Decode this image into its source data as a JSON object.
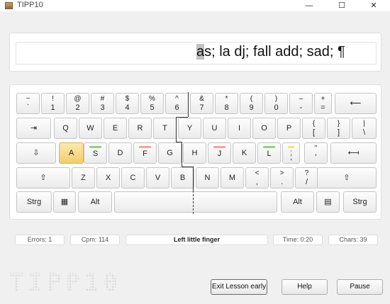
{
  "window": {
    "title": "TIPP10",
    "minimize": "—",
    "maximize": "☐",
    "close": "✕"
  },
  "text_display": {
    "before": "",
    "cursor": "a",
    "after": "s; la dj; fall add; sad; ¶"
  },
  "keyboard": {
    "rows": [
      [
        {
          "name": "key-circumflex",
          "top": "~",
          "bot": "`"
        },
        {
          "name": "key-1",
          "top": "!",
          "bot": "1"
        },
        {
          "name": "key-2",
          "top": "@",
          "bot": "2"
        },
        {
          "name": "key-3",
          "top": "#",
          "bot": "3"
        },
        {
          "name": "key-4",
          "top": "$",
          "bot": "4"
        },
        {
          "name": "key-5",
          "top": "%",
          "bot": "5"
        },
        {
          "name": "key-6",
          "top": "^",
          "bot": "6"
        },
        {
          "name": "key-7",
          "top": "&",
          "bot": "7"
        },
        {
          "name": "key-8",
          "top": "*",
          "bot": "8"
        },
        {
          "name": "key-9",
          "top": "(",
          "bot": "9"
        },
        {
          "name": "key-0",
          "top": ")",
          "bot": "0"
        },
        {
          "name": "key-minus",
          "top": "–",
          "bot": "-"
        },
        {
          "name": "key-plus",
          "top": "+",
          "bot": "="
        },
        {
          "name": "key-backspace",
          "mid": "⟵"
        }
      ],
      [
        {
          "name": "key-tab",
          "mid": "⇥"
        },
        {
          "name": "key-q",
          "mid": "Q"
        },
        {
          "name": "key-w",
          "mid": "W"
        },
        {
          "name": "key-e",
          "mid": "E"
        },
        {
          "name": "key-r",
          "mid": "R"
        },
        {
          "name": "key-t",
          "mid": "T"
        },
        {
          "name": "key-y",
          "mid": "Y"
        },
        {
          "name": "key-u",
          "mid": "U"
        },
        {
          "name": "key-i",
          "mid": "I"
        },
        {
          "name": "key-o",
          "mid": "O"
        },
        {
          "name": "key-p",
          "mid": "P"
        },
        {
          "name": "key-bracket-left",
          "top": "{",
          "bot": "["
        },
        {
          "name": "key-bracket-right",
          "top": "}",
          "bot": "]"
        },
        {
          "name": "key-backslash",
          "top": "|",
          "bot": "\\"
        }
      ],
      [
        {
          "name": "key-capslock",
          "mid": "⇩"
        },
        {
          "name": "key-a",
          "mid": "A",
          "highlight": true
        },
        {
          "name": "key-s",
          "mid": "S",
          "bar": "#8fd47a"
        },
        {
          "name": "key-d",
          "mid": "D"
        },
        {
          "name": "key-f",
          "mid": "F",
          "bar": "#f2a3a3"
        },
        {
          "name": "key-g",
          "mid": "G"
        },
        {
          "name": "key-h",
          "mid": "H"
        },
        {
          "name": "key-j",
          "mid": "J",
          "bar": "#f2a3a3"
        },
        {
          "name": "key-k",
          "mid": "K"
        },
        {
          "name": "key-l",
          "mid": "L",
          "bar": "#8fd47a"
        },
        {
          "name": "key-semicolon",
          "top": ":",
          "bot": ";",
          "bar": "#f5e27a"
        },
        {
          "name": "key-quote",
          "top": "\"",
          "bot": "'"
        },
        {
          "name": "key-enter",
          "mid": "⟻"
        }
      ],
      [
        {
          "name": "key-shift-left",
          "mid": "⇧"
        },
        {
          "name": "key-z",
          "mid": "Z"
        },
        {
          "name": "key-x",
          "mid": "X"
        },
        {
          "name": "key-c",
          "mid": "C"
        },
        {
          "name": "key-v",
          "mid": "V"
        },
        {
          "name": "key-b",
          "mid": "B"
        },
        {
          "name": "key-n",
          "mid": "N"
        },
        {
          "name": "key-m",
          "mid": "M"
        },
        {
          "name": "key-comma",
          "top": "<",
          "bot": ","
        },
        {
          "name": "key-period",
          "top": ">",
          "bot": "."
        },
        {
          "name": "key-slash",
          "top": "?",
          "bot": "/"
        },
        {
          "name": "key-shift-right",
          "mid": "⇧"
        }
      ],
      [
        {
          "name": "key-ctrl-left",
          "mid": "Strg"
        },
        {
          "name": "key-win-left",
          "mid": "▦"
        },
        {
          "name": "key-alt-left",
          "mid": "Alt"
        },
        {
          "name": "key-space",
          "mid": ""
        },
        {
          "name": "key-altgr",
          "mid": "Alt"
        },
        {
          "name": "key-menu",
          "mid": "▤"
        },
        {
          "name": "key-ctrl-right",
          "mid": "Strg"
        }
      ]
    ]
  },
  "status": {
    "errors": "Errors: 1",
    "cpm": "Cpm: 114",
    "finger": "Left little finger",
    "time": "Time: 0:20",
    "chars": "Chars: 39"
  },
  "logo_text": "TIPP10",
  "buttons": {
    "exit": "Exit Lesson early",
    "help": "Help",
    "pause": "Pause"
  }
}
